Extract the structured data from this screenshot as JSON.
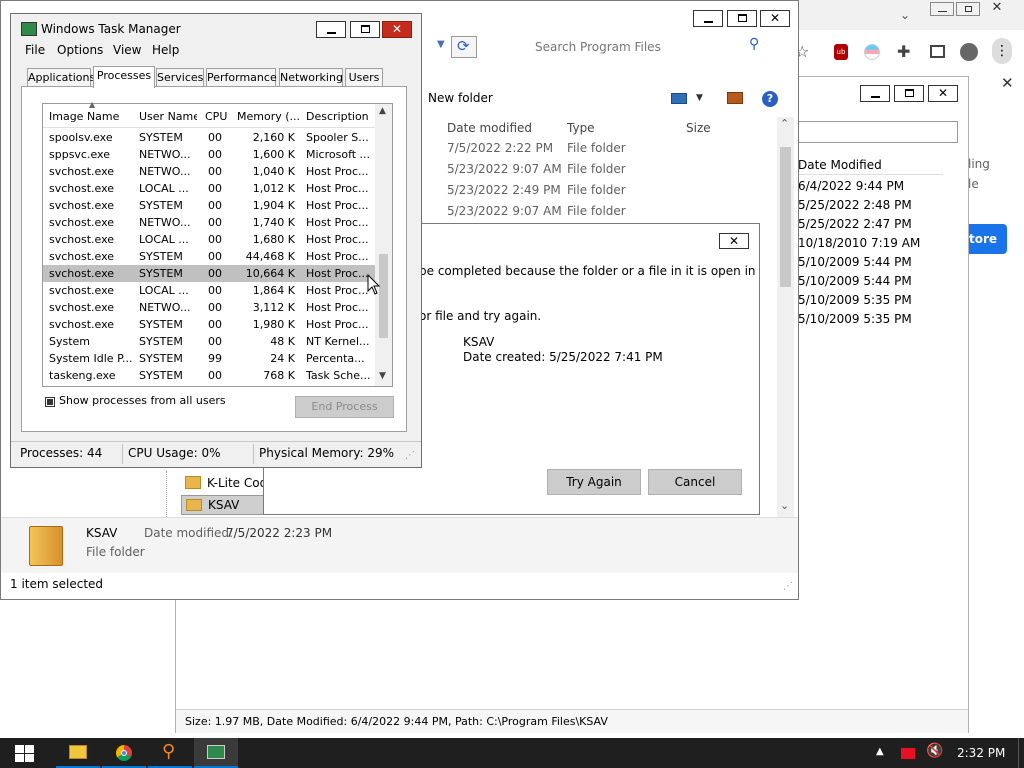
{
  "chrome": {
    "menu_icons": [
      "chevron-down-icon"
    ],
    "side": {
      "col_header": "Date Modified",
      "dates": [
        "6/4/2022 9:44 PM",
        "5/25/2022 2:48 PM",
        "5/25/2022 2:47 PM",
        "10/18/2010 7:19 AM",
        "5/10/2009 5:44 PM",
        "5/10/2009 5:44 PM",
        "5/10/2009 5:35 PM",
        "5/10/2009 5:35 PM"
      ],
      "right_frag_1": "ling",
      "right_frag_2": "le",
      "store_button": "tore"
    }
  },
  "explorer": {
    "search_placeholder": "Search Program Files",
    "new_folder": "New folder",
    "columns": [
      "Date modified",
      "Type",
      "Size"
    ],
    "rows": [
      {
        "date": "7/5/2022 2:22 PM",
        "type": "File folder"
      },
      {
        "date": "5/23/2022 9:07 AM",
        "type": "File folder"
      },
      {
        "date": "5/23/2022 2:49 PM",
        "type": "File folder"
      },
      {
        "date": "5/23/2022 9:07 AM",
        "type": "File folder"
      }
    ],
    "nav_items": [
      "K-Lite Code",
      "KSAV"
    ],
    "details": {
      "name": "KSAV",
      "modified_label": "Date modified:",
      "modified": "7/5/2022 2:23 PM",
      "type": "File folder"
    },
    "status": "1 item selected"
  },
  "dialog": {
    "message1": "be completed because the folder or a file in it is open in",
    "message2": "or file and try again.",
    "item_name": "KSAV",
    "item_created": "Date created: 5/25/2022 7:41 PM",
    "try_again": "Try Again",
    "cancel": "Cancel"
  },
  "back_window": {
    "status": "Size: 1.97 MB, Date Modified: 6/4/2022 9:44 PM, Path: C:\\Program Files\\KSAV"
  },
  "task_manager": {
    "title": "Windows Task Manager",
    "menu": [
      "File",
      "Options",
      "View",
      "Help"
    ],
    "tabs": [
      "Applications",
      "Processes",
      "Services",
      "Performance",
      "Networking",
      "Users"
    ],
    "columns": [
      "Image Name",
      "User Name",
      "CPU",
      "Memory (...",
      "Description"
    ],
    "rows": [
      {
        "name": "spoolsv.exe",
        "user": "SYSTEM",
        "cpu": "00",
        "mem": "2,160 K",
        "desc": "Spooler S..."
      },
      {
        "name": "sppsvc.exe",
        "user": "NETWO...",
        "cpu": "00",
        "mem": "1,600 K",
        "desc": "Microsoft ..."
      },
      {
        "name": "svchost.exe",
        "user": "NETWO...",
        "cpu": "00",
        "mem": "1,040 K",
        "desc": "Host Proc..."
      },
      {
        "name": "svchost.exe",
        "user": "LOCAL ...",
        "cpu": "00",
        "mem": "1,012 K",
        "desc": "Host Proc..."
      },
      {
        "name": "svchost.exe",
        "user": "SYSTEM",
        "cpu": "00",
        "mem": "1,904 K",
        "desc": "Host Proc..."
      },
      {
        "name": "svchost.exe",
        "user": "NETWO...",
        "cpu": "00",
        "mem": "1,740 K",
        "desc": "Host Proc..."
      },
      {
        "name": "svchost.exe",
        "user": "LOCAL ...",
        "cpu": "00",
        "mem": "1,680 K",
        "desc": "Host Proc..."
      },
      {
        "name": "svchost.exe",
        "user": "SYSTEM",
        "cpu": "00",
        "mem": "44,468 K",
        "desc": "Host Proc..."
      },
      {
        "name": "svchost.exe",
        "user": "SYSTEM",
        "cpu": "00",
        "mem": "10,664 K",
        "desc": "Host Proc..."
      },
      {
        "name": "svchost.exe",
        "user": "LOCAL ...",
        "cpu": "00",
        "mem": "1,864 K",
        "desc": "Host Proc..."
      },
      {
        "name": "svchost.exe",
        "user": "NETWO...",
        "cpu": "00",
        "mem": "3,112 K",
        "desc": "Host Proc..."
      },
      {
        "name": "svchost.exe",
        "user": "SYSTEM",
        "cpu": "00",
        "mem": "1,980 K",
        "desc": "Host Proc..."
      },
      {
        "name": "System",
        "user": "SYSTEM",
        "cpu": "00",
        "mem": "48 K",
        "desc": "NT Kernel..."
      },
      {
        "name": "System Idle P...",
        "user": "SYSTEM",
        "cpu": "99",
        "mem": "24 K",
        "desc": "Percenta..."
      },
      {
        "name": "taskeng.exe",
        "user": "SYSTEM",
        "cpu": "00",
        "mem": "768 K",
        "desc": "Task Sche..."
      }
    ],
    "selected_row": 8,
    "show_all": "Show processes from all users",
    "end_process": "End Process",
    "status_processes": "Processes: 44",
    "status_cpu": "CPU Usage: 0%",
    "status_memory": "Physical Memory: 29%"
  },
  "taskbar": {
    "time": "2:32 PM",
    "colors": {
      "bar": "#1f1f1f",
      "accent": "#0078d7"
    }
  }
}
